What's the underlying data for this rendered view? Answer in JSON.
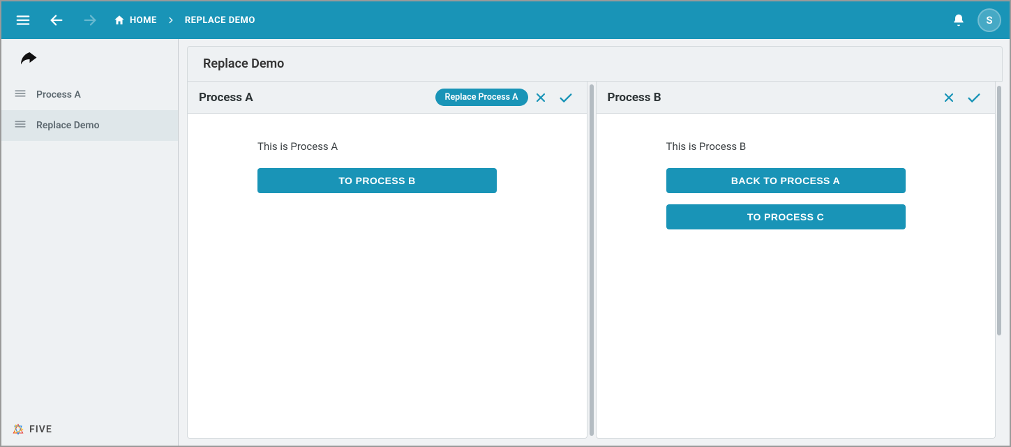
{
  "colors": {
    "primary": "#1994b7"
  },
  "topbar": {
    "home_label": "HOME",
    "current_page": "REPLACE DEMO",
    "avatar_initial": "S"
  },
  "sidebar": {
    "items": [
      {
        "label": "Process A",
        "selected": false
      },
      {
        "label": "Replace Demo",
        "selected": true
      }
    ],
    "footer_brand": "FIVE"
  },
  "page": {
    "title": "Replace Demo"
  },
  "panels": [
    {
      "title": "Process A",
      "chip": "Replace Process A",
      "description": "This is Process A",
      "buttons": [
        {
          "label": "TO PROCESS B"
        }
      ]
    },
    {
      "title": "Process B",
      "chip": null,
      "description": "This is Process B",
      "buttons": [
        {
          "label": "BACK TO PROCESS A"
        },
        {
          "label": "TO PROCESS C"
        }
      ]
    }
  ]
}
